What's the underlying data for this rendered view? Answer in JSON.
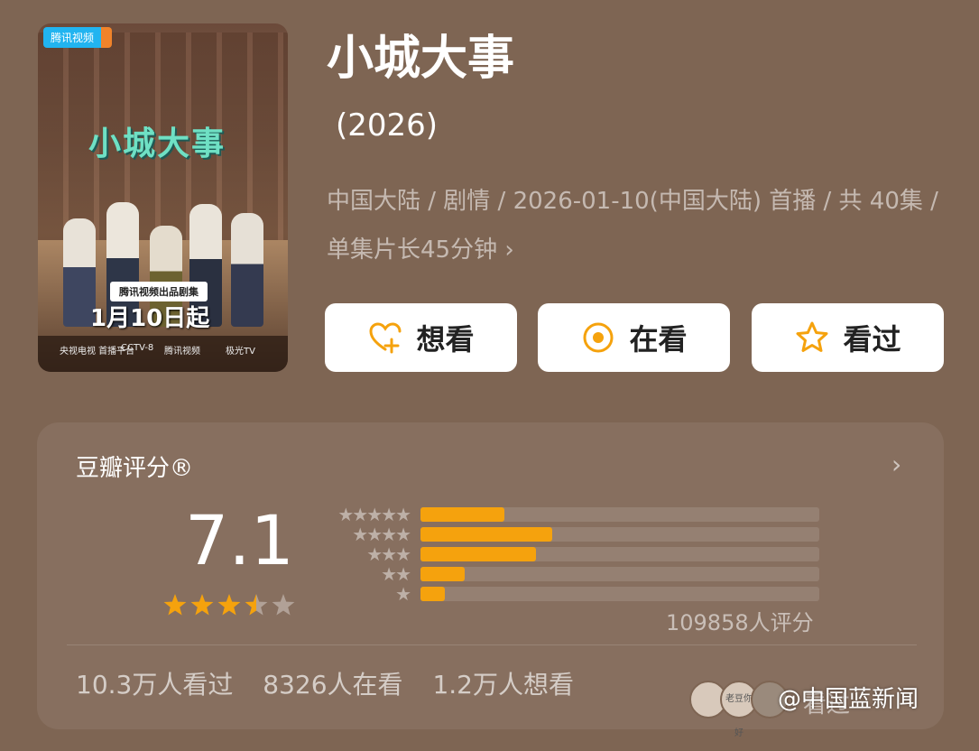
{
  "poster": {
    "logo": "腾讯视频",
    "title": "小城大事",
    "badge": "腾讯视频出品剧集",
    "date": "1月10日起",
    "footer_left": "央视电视 首播平台",
    "footer_mid": "CCTV-8",
    "footer_platform": "腾讯视频",
    "footer_right": "极光TV"
  },
  "header": {
    "title": "小城大事",
    "year": "(2026)",
    "meta": "中国大陆 / 剧情 / 2026-01-10(中国大陆) 首播 / 共 40集 / 单集片长45分钟"
  },
  "actions": {
    "want": "想看",
    "watching": "在看",
    "watched": "看过"
  },
  "rating": {
    "title": "豆瓣评分®",
    "score": "7.1",
    "stars_value": 3.5,
    "count_text": "109858人评分",
    "distribution": [
      {
        "stars": 5,
        "fraction": 0.21
      },
      {
        "stars": 4,
        "fraction": 0.33
      },
      {
        "stars": 3,
        "fraction": 0.29
      },
      {
        "stars": 2,
        "fraction": 0.11
      },
      {
        "stars": 1,
        "fraction": 0.06
      }
    ]
  },
  "stats": {
    "watched": "10.3万人看过",
    "watching": "8326人在看",
    "want": "1.2万人想看"
  },
  "bottom": {
    "avatar_text": "老豆你好",
    "watched_label": "看过"
  },
  "watermark": "@中国蓝新闻",
  "colors": {
    "background": "#7e6553",
    "accent": "#f5a20d"
  }
}
